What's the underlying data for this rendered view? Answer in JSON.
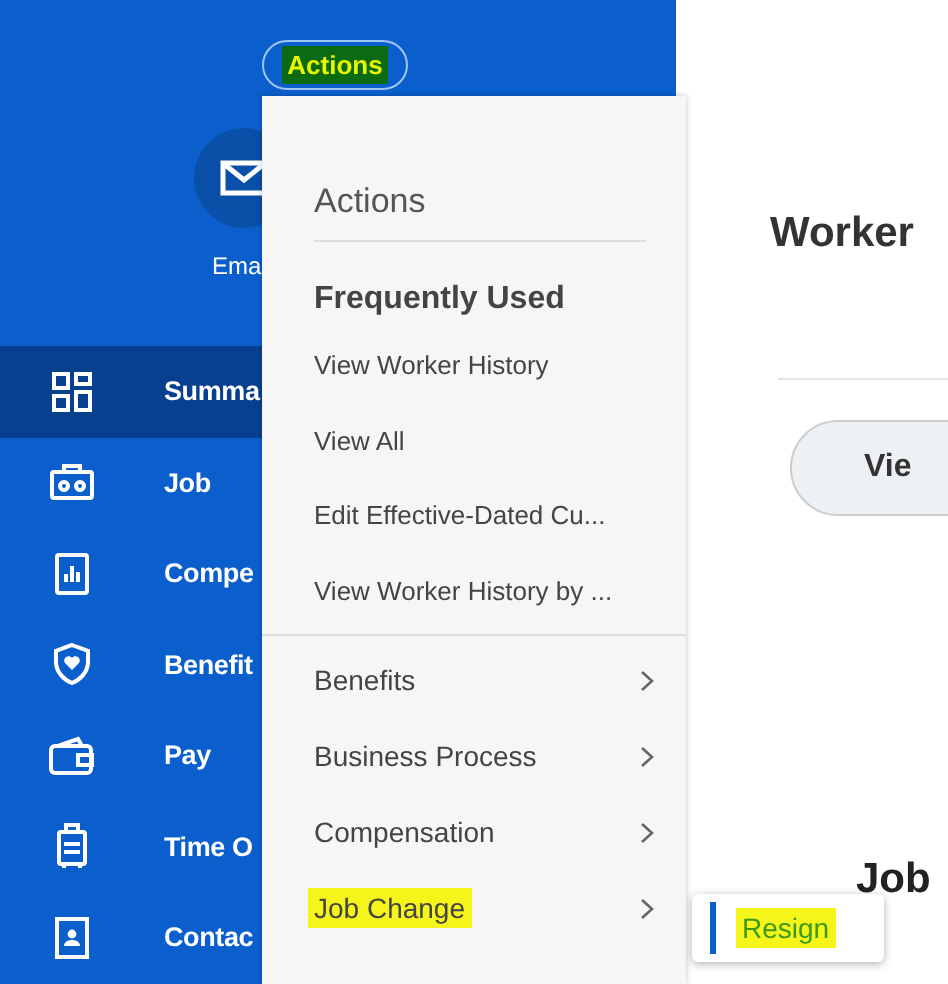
{
  "header": {
    "actions_button": {
      "label": "Actions",
      "highlighted": true
    }
  },
  "profile": {
    "email_label": "Ema"
  },
  "sidebar": {
    "items": [
      {
        "label": "Summa",
        "selected": true
      },
      {
        "label": "Job",
        "selected": false
      },
      {
        "label": "Compe",
        "selected": false
      },
      {
        "label": "Benefit",
        "selected": false
      },
      {
        "label": "Pay",
        "selected": false
      },
      {
        "label": "Time O",
        "selected": false
      },
      {
        "label": "Contac",
        "selected": false
      }
    ]
  },
  "actions_menu": {
    "title": "Actions",
    "section_title": "Frequently Used",
    "frequent_items": [
      "View Worker History",
      "View All",
      "Edit Effective-Dated Cu...",
      "View Worker History by ..."
    ],
    "category_items": [
      {
        "label": "Benefits",
        "highlighted": false
      },
      {
        "label": "Business Process",
        "highlighted": false
      },
      {
        "label": "Compensation",
        "highlighted": false
      },
      {
        "label": "Job Change",
        "highlighted": true
      }
    ],
    "submenu": {
      "items": [
        {
          "label": "Resign",
          "highlighted": true
        }
      ]
    }
  },
  "content": {
    "heading": "Worker",
    "button_label": "Vie",
    "section_heading": "Job"
  }
}
